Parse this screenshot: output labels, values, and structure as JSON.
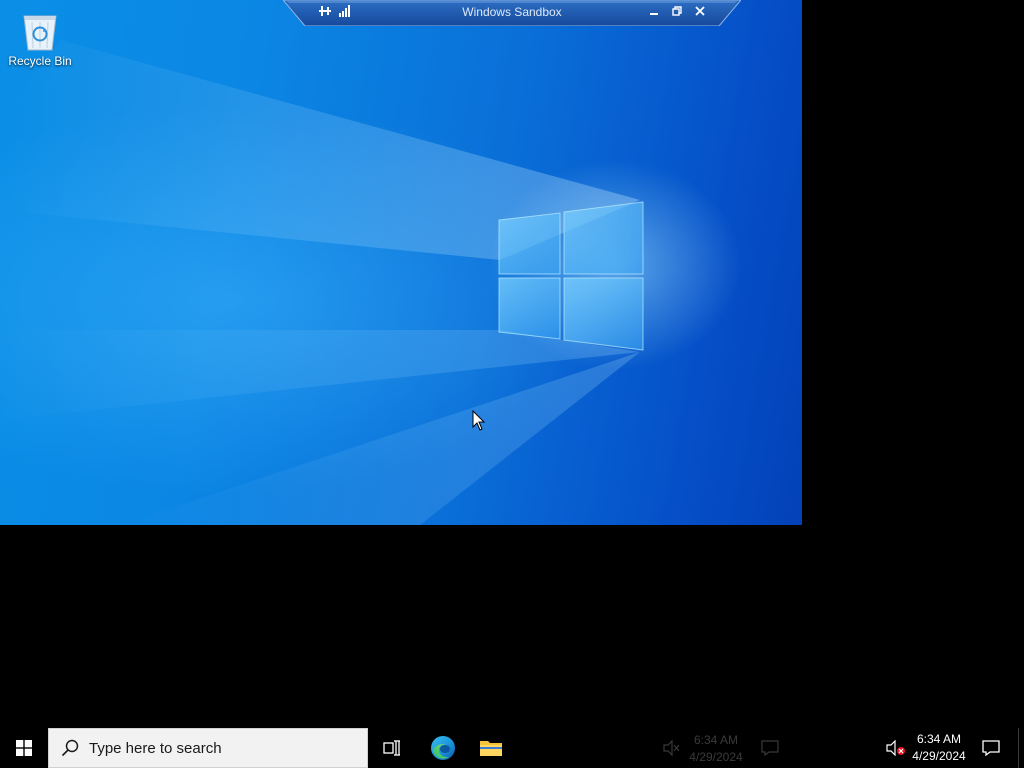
{
  "sandbox_bar": {
    "title": "Windows Sandbox",
    "pin_icon": "pin-icon",
    "signal_icon": "connection-signal-icon",
    "minimize_icon": "minimize-icon",
    "restore_icon": "restore-icon",
    "close_icon": "close-icon"
  },
  "desktop": {
    "icons": [
      {
        "label": "Recycle Bin",
        "icon": "recycle-bin-icon"
      }
    ]
  },
  "taskbar": {
    "start_icon": "windows-start-icon",
    "search": {
      "placeholder": "Type here to search",
      "icon": "search-icon"
    },
    "pinned": [
      {
        "name": "task-view",
        "icon": "task-view-icon"
      },
      {
        "name": "edge",
        "icon": "edge-icon"
      },
      {
        "name": "file-explorer",
        "icon": "folder-icon"
      }
    ],
    "ghost_tray": {
      "time": "6:34 AM",
      "date": "4/29/2024"
    },
    "tray": {
      "volume_icon": "volume-muted-icon",
      "time": "6:34 AM",
      "date": "4/29/2024",
      "notification_icon": "notification-icon"
    }
  },
  "colors": {
    "desktop_blue": "#0a86e2",
    "desktop_blue_dark": "#0341b8",
    "taskbar": "#000000",
    "search_bg": "#f2f2f2",
    "sandbox_bar": "#1a5cb4",
    "folder_yellow": "#f5c33b"
  }
}
